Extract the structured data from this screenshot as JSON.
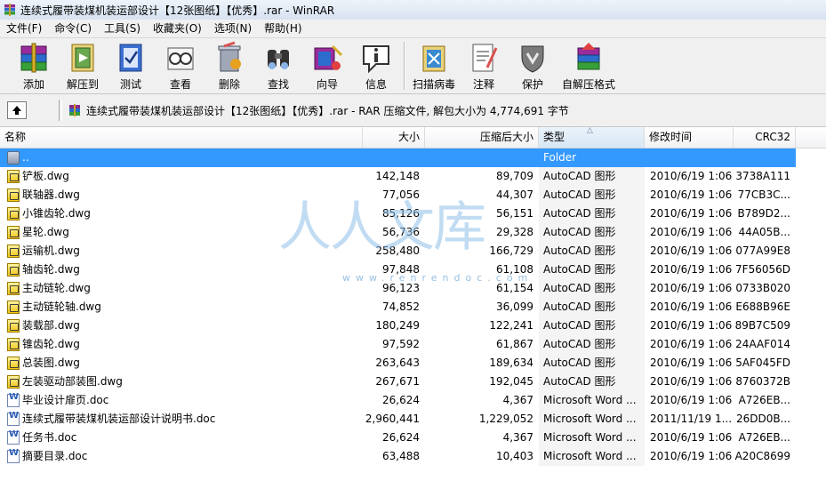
{
  "window": {
    "title": "连续式履带装煤机装运部设计【12张图纸】【优秀】.rar - WinRAR"
  },
  "menu": [
    "文件(F)",
    "命令(C)",
    "工具(S)",
    "收藏夹(O)",
    "选项(N)",
    "帮助(H)"
  ],
  "toolbar": [
    {
      "label": "添加",
      "icon": "add-archive-icon"
    },
    {
      "label": "解压到",
      "icon": "extract-to-icon"
    },
    {
      "label": "测试",
      "icon": "test-icon"
    },
    {
      "label": "查看",
      "icon": "view-icon"
    },
    {
      "label": "删除",
      "icon": "delete-icon"
    },
    {
      "label": "查找",
      "icon": "find-icon"
    },
    {
      "label": "向导",
      "icon": "wizard-icon"
    },
    {
      "label": "信息",
      "icon": "info-icon"
    },
    {
      "label": "扫描病毒",
      "icon": "virus-scan-icon"
    },
    {
      "label": "注释",
      "icon": "comment-icon"
    },
    {
      "label": "保护",
      "icon": "protect-icon"
    },
    {
      "label": "自解压格式",
      "icon": "sfx-icon"
    }
  ],
  "address": {
    "text": "连续式履带装煤机装运部设计【12张图纸】【优秀】.rar - RAR 压缩文件, 解包大小为 4,774,691 字节"
  },
  "columns": {
    "name": "名称",
    "size": "大小",
    "packed": "压缩后大小",
    "type": "类型",
    "modified": "修改时间",
    "crc": "CRC32"
  },
  "files": [
    {
      "name": "..",
      "size": "",
      "packed": "",
      "type": "Folder",
      "modified": "",
      "crc": "",
      "kind": "folder"
    },
    {
      "name": "铲板.dwg",
      "size": "142,148",
      "packed": "89,709",
      "type": "AutoCAD 图形",
      "modified": "2010/6/19 1:06",
      "crc": "3738A111",
      "kind": "dwg"
    },
    {
      "name": "联轴器.dwg",
      "size": "77,056",
      "packed": "44,307",
      "type": "AutoCAD 图形",
      "modified": "2010/6/19 1:06",
      "crc": "77CB3C...",
      "kind": "dwg"
    },
    {
      "name": "小锥齿轮.dwg",
      "size": "85,126",
      "packed": "56,151",
      "type": "AutoCAD 图形",
      "modified": "2010/6/19 1:06",
      "crc": "B789D2...",
      "kind": "dwg"
    },
    {
      "name": "星轮.dwg",
      "size": "56,736",
      "packed": "29,328",
      "type": "AutoCAD 图形",
      "modified": "2010/6/19 1:06",
      "crc": "44A05B...",
      "kind": "dwg"
    },
    {
      "name": "运输机.dwg",
      "size": "258,480",
      "packed": "166,729",
      "type": "AutoCAD 图形",
      "modified": "2010/6/19 1:06",
      "crc": "077A99E8",
      "kind": "dwg"
    },
    {
      "name": "轴齿轮.dwg",
      "size": "97,848",
      "packed": "61,108",
      "type": "AutoCAD 图形",
      "modified": "2010/6/19 1:06",
      "crc": "7F56056D",
      "kind": "dwg"
    },
    {
      "name": "主动链轮.dwg",
      "size": "96,123",
      "packed": "61,154",
      "type": "AutoCAD 图形",
      "modified": "2010/6/19 1:06",
      "crc": "0733B020",
      "kind": "dwg"
    },
    {
      "name": "主动链轮轴.dwg",
      "size": "74,852",
      "packed": "36,099",
      "type": "AutoCAD 图形",
      "modified": "2010/6/19 1:06",
      "crc": "E688B96E",
      "kind": "dwg"
    },
    {
      "name": "装载部.dwg",
      "size": "180,249",
      "packed": "122,241",
      "type": "AutoCAD 图形",
      "modified": "2010/6/19 1:06",
      "crc": "89B7C509",
      "kind": "dwg"
    },
    {
      "name": "锥齿轮.dwg",
      "size": "97,592",
      "packed": "61,867",
      "type": "AutoCAD 图形",
      "modified": "2010/6/19 1:06",
      "crc": "24AAF014",
      "kind": "dwg"
    },
    {
      "name": "总装图.dwg",
      "size": "263,643",
      "packed": "189,634",
      "type": "AutoCAD 图形",
      "modified": "2010/6/19 1:06",
      "crc": "5AF045FD",
      "kind": "dwg"
    },
    {
      "name": "左装驱动部装图.dwg",
      "size": "267,671",
      "packed": "192,045",
      "type": "AutoCAD 图形",
      "modified": "2010/6/19 1:06",
      "crc": "8760372B",
      "kind": "dwg"
    },
    {
      "name": "毕业设计扉页.doc",
      "size": "26,624",
      "packed": "4,367",
      "type": "Microsoft Word ...",
      "modified": "2010/6/19 1:06",
      "crc": "A726EB...",
      "kind": "doc"
    },
    {
      "name": "连续式履带装煤机装运部设计说明书.doc",
      "size": "2,960,441",
      "packed": "1,229,052",
      "type": "Microsoft Word ...",
      "modified": "2011/11/19 1...",
      "crc": "26DD0B...",
      "kind": "doc"
    },
    {
      "name": "任务书.doc",
      "size": "26,624",
      "packed": "4,367",
      "type": "Microsoft Word ...",
      "modified": "2010/6/19 1:06",
      "crc": "A726EB...",
      "kind": "doc"
    },
    {
      "name": "摘要目录.doc",
      "size": "63,488",
      "packed": "10,403",
      "type": "Microsoft Word ...",
      "modified": "2010/6/19 1:06",
      "crc": "A20C8699",
      "kind": "doc"
    }
  ],
  "watermark": {
    "text": "人人文库",
    "url": "www.renrendoc.com"
  },
  "colors": {
    "selection": "#3399ff",
    "toolbar_bg": "#f0f0f0"
  }
}
